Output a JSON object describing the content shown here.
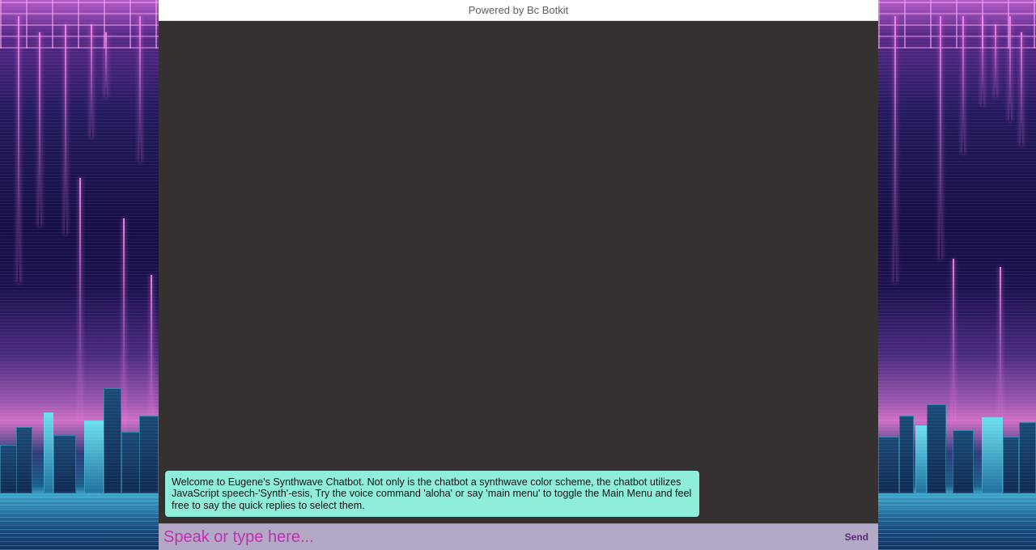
{
  "header": {
    "powered_by": "Powered by Bc Botkit"
  },
  "messages": [
    {
      "from": "bot",
      "text": "Welcome to Eugene's Synthwave Chatbot. Not only is the chatbot a synthwave color scheme, the chatbot utilizes JavaScript speech-'Synth'-esis, Try the voice command 'aloha' or say 'main menu' to toggle the Main Menu and feel free to say the quick replies to select them."
    }
  ],
  "composer": {
    "placeholder": "Speak or type here...",
    "value": "",
    "send_label": "Send"
  },
  "colors": {
    "chat_background": "#353131",
    "bot_bubble": "#8feed9",
    "composer_background": "#b3a9c6",
    "placeholder_text": "#c22fb4",
    "send_text": "#5a2d7a"
  }
}
